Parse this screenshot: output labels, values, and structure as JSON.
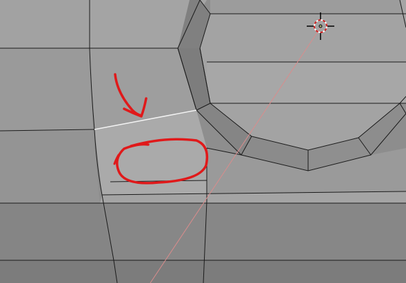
{
  "viewport": {
    "mode": "edit-mode-mesh-view",
    "theme": {
      "background": "#8a8a8a",
      "face_light": "#a6a6a6",
      "face_mid": "#9a9a9a",
      "face_dark": "#8a8a8a",
      "face_darker": "#7e7e7e",
      "edge_color": "#1a1a1a",
      "selected_edge_color": "#f2f2f2",
      "selected_face_tint": "#aaaaaa",
      "annotation_color": "#e0191a",
      "cursor_ring": "#d02020",
      "projection_line": "#d98c8c"
    },
    "selection": {
      "edges_selected": 1
    },
    "annotations": {
      "arrow": "red-arrow-annotation",
      "circle": "red-circle-annotation"
    },
    "cursor": {
      "icon": "3d-cursor-icon"
    }
  }
}
